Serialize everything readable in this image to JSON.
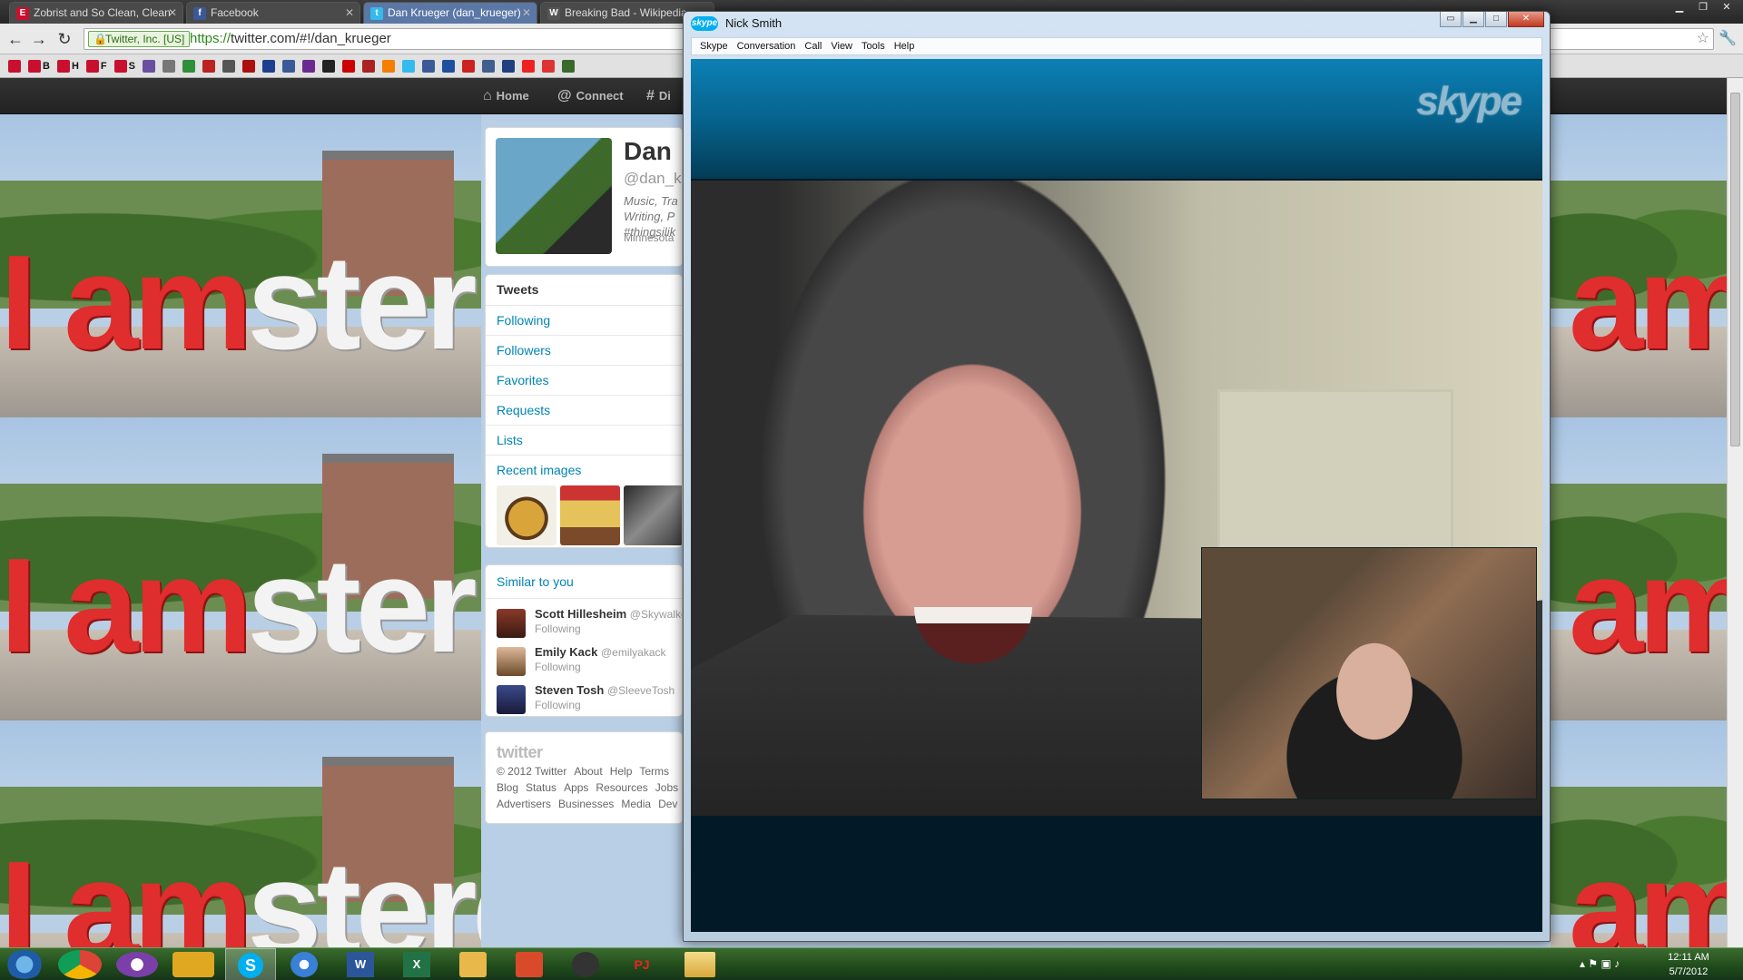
{
  "browser": {
    "tabs": [
      {
        "title": "Zobrist and So Clean, Clean",
        "icon": "E",
        "icon_color": "#c8102e"
      },
      {
        "title": "Facebook",
        "icon": "f",
        "icon_color": "#3b5998"
      },
      {
        "title": "Dan Krueger (dan_krueger)",
        "icon": "t",
        "icon_color": "#33bbee"
      },
      {
        "title": "Breaking Bad - Wikipedia",
        "icon": "W",
        "icon_color": "#555555"
      }
    ],
    "ev_label": "Twitter, Inc. [US]",
    "url_scheme": "https://",
    "url_rest": "twitter.com/#!/dan_krueger",
    "bookmarks": [
      "B",
      "H",
      "F",
      "S"
    ]
  },
  "twitter": {
    "topnav": {
      "home": "Home",
      "connect": "Connect",
      "discover": "Di"
    },
    "profile": {
      "name": "Dan",
      "handle": "@dan_k",
      "bio": "Music, Tra\nWriting, P\n#thingsilik",
      "location": "Minnesota"
    },
    "sidebar": [
      {
        "label": "Tweets"
      },
      {
        "label": "Following"
      },
      {
        "label": "Followers"
      },
      {
        "label": "Favorites"
      },
      {
        "label": "Requests"
      },
      {
        "label": "Lists"
      },
      {
        "label": "Recent images"
      }
    ],
    "similar": {
      "title": "Similar to you",
      "people": [
        {
          "name": "Scott Hillesheim",
          "handle": "@Skywalke",
          "status": "Following"
        },
        {
          "name": "Emily Kack",
          "handle": "@emilyakack",
          "status": "Following"
        },
        {
          "name": "Steven Tosh",
          "handle": "@SleeveTosh",
          "status": "Following"
        }
      ]
    },
    "footer": {
      "logo": "twitter",
      "line1": [
        "© 2012 Twitter",
        "About",
        "Help",
        "Terms"
      ],
      "line2": [
        "Blog",
        "Status",
        "Apps",
        "Resources",
        "Jobs"
      ],
      "line3": [
        "Advertisers",
        "Businesses",
        "Media",
        "Dev"
      ]
    }
  },
  "skype": {
    "logo_small": "skype",
    "title": "Nick Smith",
    "menu": [
      "Skype",
      "Conversation",
      "Call",
      "View",
      "Tools",
      "Help"
    ],
    "brand": "skype"
  },
  "taskbar": {
    "time": "12:11 AM",
    "date": "5/7/2012",
    "apps": [
      "chrome",
      "itunes-alt",
      "folder-gold",
      "skype",
      "itunes",
      "word",
      "excel",
      "outlook",
      "media",
      "steam",
      "pj64",
      "explorer"
    ]
  }
}
